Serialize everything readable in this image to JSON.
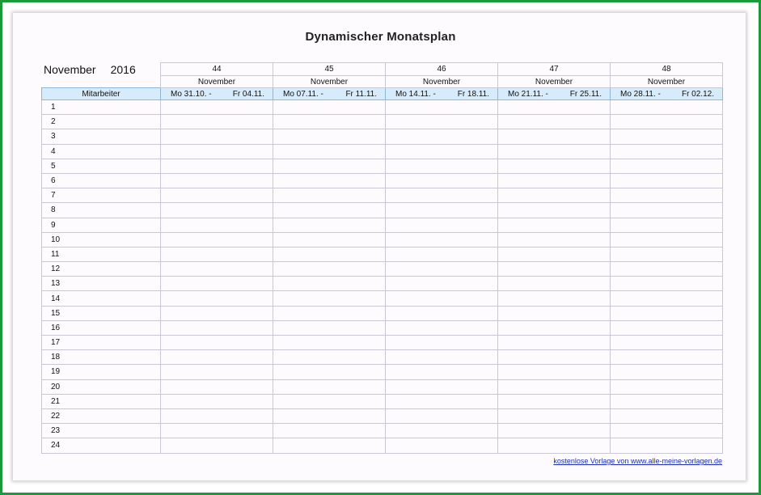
{
  "title": "Dynamischer Monatsplan",
  "month": "November",
  "year": "2016",
  "employee_header": "Mitarbeiter",
  "weeks": [
    {
      "num": "44",
      "month": "November",
      "start": "Mo 31.10. -",
      "end": "Fr 04.11."
    },
    {
      "num": "45",
      "month": "November",
      "start": "Mo 07.11. -",
      "end": "Fr 11.11."
    },
    {
      "num": "46",
      "month": "November",
      "start": "Mo 14.11. -",
      "end": "Fr 18.11."
    },
    {
      "num": "47",
      "month": "November",
      "start": "Mo 21.11. -",
      "end": "Fr 25.11."
    },
    {
      "num": "48",
      "month": "November",
      "start": "Mo 28.11. -",
      "end": "Fr 02.12."
    }
  ],
  "rows": [
    "1",
    "2",
    "3",
    "4",
    "5",
    "6",
    "7",
    "8",
    "9",
    "10",
    "11",
    "12",
    "13",
    "14",
    "15",
    "16",
    "17",
    "18",
    "19",
    "20",
    "21",
    "22",
    "23",
    "24"
  ],
  "footer_link": "kostenlose Vorlage von www.alle-meine-vorlagen.de",
  "colors": {
    "frame": "#1a9a3a",
    "date_row": "#d6ecfa",
    "link": "#1b2db8"
  }
}
